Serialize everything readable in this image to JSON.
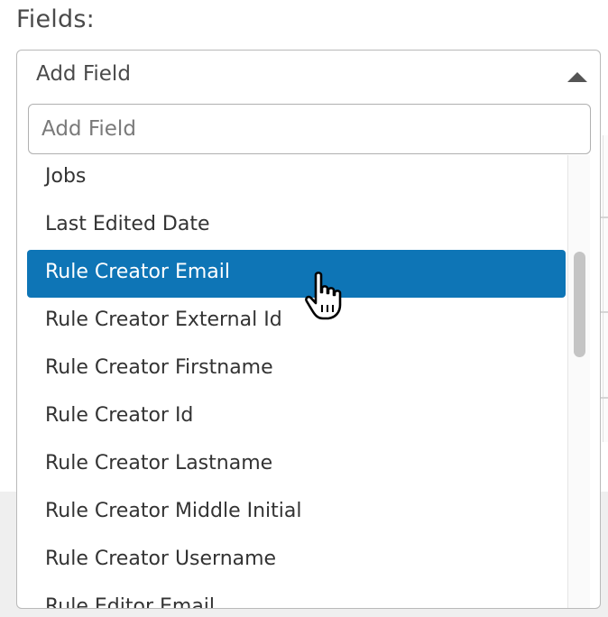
{
  "fields_label": "Fields:",
  "dropdown": {
    "selected_label": "Add Field",
    "search_placeholder": "Add Field",
    "options": [
      "Jobs",
      "Last Edited Date",
      "Rule Creator Email",
      "Rule Creator External Id",
      "Rule Creator Firstname",
      "Rule Creator Id",
      "Rule Creator Lastname",
      "Rule Creator Middle Initial",
      "Rule Creator Username",
      "Rule Editor Email"
    ],
    "highlighted_option": "Rule Creator Email"
  },
  "colors": {
    "highlight": "#0e75b6",
    "border": "#b9b9b9",
    "text": "#333333"
  },
  "icons": {
    "caret": "caret-up-icon",
    "cursor": "hand-pointer-icon"
  }
}
